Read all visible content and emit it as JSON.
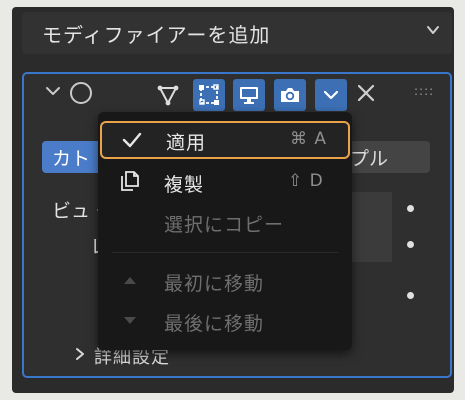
{
  "add_modifier": {
    "label": "モディファイアーを追加",
    "chevron_icon": "chevron-down-icon"
  },
  "modifier_header": {
    "collapse_icon": "chevron-down-icon",
    "type_icon": "circle-outline-icon",
    "toggles": [
      {
        "name": "edit-mode-toggle",
        "icon": "vertex-triangle-icon",
        "active": false
      },
      {
        "name": "edit-cage-toggle",
        "icon": "vertex-square-icon",
        "active": true
      },
      {
        "name": "viewport-toggle",
        "icon": "monitor-icon",
        "active": true
      },
      {
        "name": "render-toggle",
        "icon": "camera-icon",
        "active": true
      }
    ],
    "dropdown_icon": "chevron-down-icon",
    "close_icon": "close-icon",
    "grip_label": "::::"
  },
  "panel": {
    "tab_left": "カト",
    "tab_right": "プル",
    "view_label": "ビュ・",
    "l_label": "レ",
    "advanced_label": "詳細設定"
  },
  "menu": {
    "items": [
      {
        "label": "適用",
        "shortcut": "⌘ A",
        "icon": "checkmark-icon",
        "enabled": true,
        "highlighted": true
      },
      {
        "label": "複製",
        "shortcut": "⇧ D",
        "icon": "duplicate-icon",
        "enabled": true,
        "highlighted": false
      },
      {
        "label": "選択にコピー",
        "shortcut": "",
        "icon": "",
        "enabled": false,
        "highlighted": false
      },
      {
        "label": "最初に移動",
        "shortcut": "",
        "icon": "triangle-up-icon",
        "enabled": false,
        "highlighted": false
      },
      {
        "label": "最後に移動",
        "shortcut": "",
        "icon": "triangle-down-icon",
        "enabled": false,
        "highlighted": false
      }
    ]
  },
  "colors": {
    "accent_blue": "#3c6fb4",
    "highlight_border": "#e9a34a",
    "menu_bg": "#181818",
    "panel_bg": "#2b2b2b"
  }
}
